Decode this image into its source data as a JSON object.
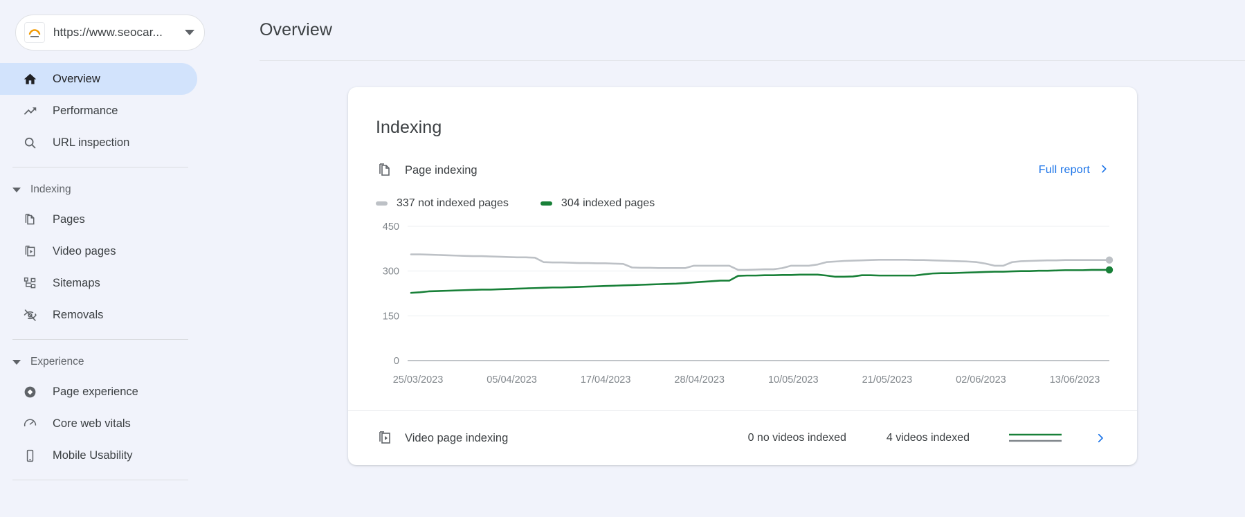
{
  "site_picker": {
    "url": "https://www.seocar...",
    "favicon_name": "site-favicon",
    "caret_name": "chevron-down-icon"
  },
  "sidebar": {
    "items": [
      {
        "label": "Overview",
        "icon": "home-icon",
        "active": true
      },
      {
        "label": "Performance",
        "icon": "trending-up-icon",
        "active": false
      },
      {
        "label": "URL inspection",
        "icon": "search-icon",
        "active": false
      }
    ],
    "groups": [
      {
        "label": "Indexing",
        "items": [
          {
            "label": "Pages",
            "icon": "pages-icon"
          },
          {
            "label": "Video pages",
            "icon": "video-pages-icon"
          },
          {
            "label": "Sitemaps",
            "icon": "sitemaps-icon"
          },
          {
            "label": "Removals",
            "icon": "eye-off-icon"
          }
        ]
      },
      {
        "label": "Experience",
        "items": [
          {
            "label": "Page experience",
            "icon": "page-experience-icon"
          },
          {
            "label": "Core web vitals",
            "icon": "speedometer-icon"
          },
          {
            "label": "Mobile Usability",
            "icon": "mobile-icon"
          }
        ]
      }
    ]
  },
  "header": {
    "title": "Overview"
  },
  "card": {
    "title": "Indexing",
    "page_indexing": {
      "label": "Page indexing",
      "icon": "pages-icon",
      "full_report_label": "Full report",
      "full_report_chevron": "chevron-right-icon"
    },
    "video_indexing": {
      "label": "Video page indexing",
      "icon": "video-pages-icon",
      "stat_not_indexed": "0 no videos indexed",
      "stat_indexed": "4 videos indexed",
      "chevron": "chevron-right-icon"
    }
  },
  "colors": {
    "indexed_green": "#188038",
    "not_indexed_grey": "#bdc1c6",
    "link_blue": "#1a73e8",
    "active_pill": "#d2e3fc",
    "page_bg": "#f1f3fb"
  },
  "chart_data": {
    "type": "line",
    "title": "Page indexing",
    "xlabel": "",
    "ylabel": "",
    "ylim": [
      0,
      450
    ],
    "yticks": [
      450,
      300,
      150,
      0
    ],
    "grid": true,
    "legend_position": "top-left",
    "x_tick_labels": [
      "25/03/2023",
      "05/04/2023",
      "17/04/2023",
      "28/04/2023",
      "10/05/2023",
      "21/05/2023",
      "02/06/2023",
      "13/06/2023"
    ],
    "series": [
      {
        "name": "337 not indexed pages",
        "color": "#bdc1c6",
        "end_value": 337,
        "values": [
          356,
          356,
          355,
          354,
          353,
          352,
          351,
          350,
          350,
          349,
          348,
          347,
          346,
          346,
          345,
          330,
          329,
          329,
          328,
          327,
          327,
          326,
          326,
          325,
          324,
          312,
          311,
          311,
          310,
          310,
          310,
          310,
          318,
          318,
          318,
          318,
          318,
          304,
          304,
          305,
          306,
          306,
          310,
          318,
          318,
          318,
          322,
          330,
          332,
          334,
          335,
          336,
          337,
          338,
          338,
          338,
          338,
          337,
          337,
          336,
          335,
          334,
          333,
          332,
          330,
          325,
          318,
          318,
          330,
          333,
          334,
          335,
          336,
          336,
          337,
          337,
          337,
          337,
          337,
          337
        ]
      },
      {
        "name": "304 indexed pages",
        "color": "#188038",
        "end_value": 304,
        "values": [
          227,
          229,
          232,
          233,
          234,
          235,
          236,
          237,
          238,
          238,
          239,
          240,
          241,
          242,
          243,
          244,
          245,
          245,
          246,
          247,
          248,
          249,
          250,
          251,
          252,
          253,
          254,
          255,
          256,
          257,
          258,
          260,
          262,
          264,
          266,
          268,
          268,
          284,
          285,
          285,
          286,
          286,
          287,
          287,
          288,
          288,
          288,
          285,
          281,
          281,
          282,
          286,
          286,
          285,
          285,
          285,
          285,
          285,
          289,
          292,
          293,
          293,
          294,
          295,
          296,
          297,
          298,
          298,
          299,
          300,
          300,
          301,
          301,
          302,
          303,
          303,
          303,
          304,
          304,
          304
        ]
      }
    ]
  }
}
